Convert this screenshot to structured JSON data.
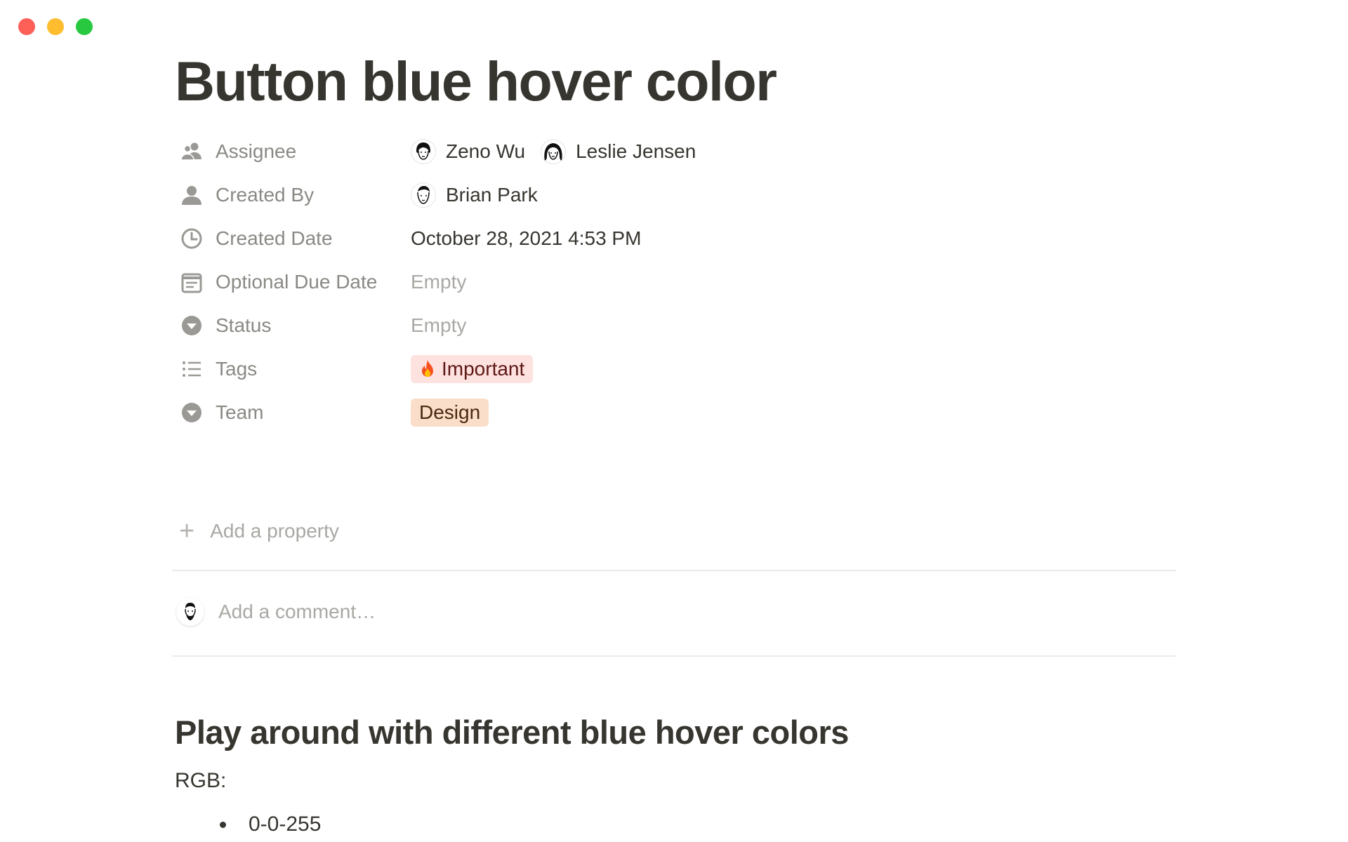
{
  "window": {
    "controls": [
      "close",
      "minimize",
      "maximize"
    ]
  },
  "page": {
    "title": "Button blue hover color"
  },
  "properties": {
    "assignee": {
      "label": "Assignee",
      "icon": "people-icon",
      "people": [
        {
          "name": "Zeno Wu"
        },
        {
          "name": "Leslie Jensen"
        }
      ]
    },
    "created_by": {
      "label": "Created By",
      "icon": "person-icon",
      "people": [
        {
          "name": "Brian Park"
        }
      ]
    },
    "created_date": {
      "label": "Created Date",
      "icon": "clock-icon",
      "value": "October 28, 2021 4:53 PM"
    },
    "due_date": {
      "label": "Optional Due Date",
      "icon": "calendar-icon",
      "value": "Empty"
    },
    "status": {
      "label": "Status",
      "icon": "select-arrow-icon",
      "value": "Empty"
    },
    "tags": {
      "label": "Tags",
      "icon": "list-icon",
      "value": "Important",
      "emoji_icon": "fire-icon",
      "color": "#fde2df"
    },
    "team": {
      "label": "Team",
      "icon": "select-arrow-icon",
      "value": "Design",
      "color": "#fadec9"
    },
    "add_property": "Add a property"
  },
  "comment": {
    "placeholder": "Add a comment…"
  },
  "content": {
    "heading": "Play around with different blue hover colors",
    "paragraph": "RGB:",
    "bullets": [
      "0-0-255"
    ]
  }
}
